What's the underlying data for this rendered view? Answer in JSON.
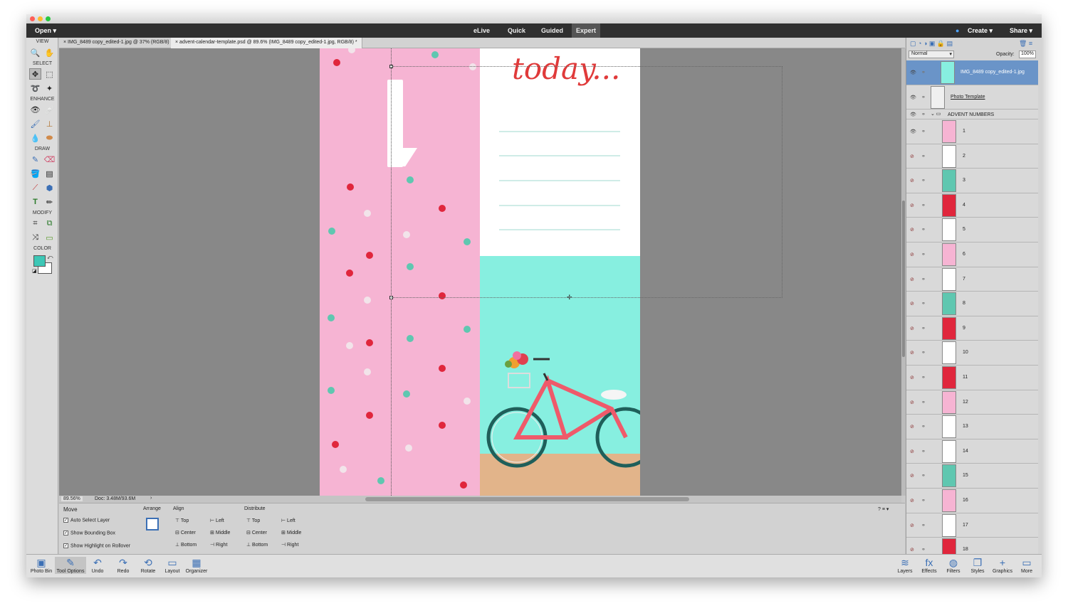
{
  "menubar": {
    "open_label": "Open",
    "modes": [
      "eLive",
      "Quick",
      "Guided",
      "Expert"
    ],
    "active_mode": "Expert",
    "create_label": "Create",
    "share_label": "Share"
  },
  "tabs": [
    {
      "label": "IMG_8489 copy_edited-1.jpg @ 37% (RGB/8)"
    },
    {
      "label": "advent-calendar-template.psd @ 89.6% (IMG_8489 copy_edited-1.jpg, RGB/8) *"
    }
  ],
  "toolbox": {
    "sections": [
      "VIEW",
      "SELECT",
      "ENHANCE",
      "DRAW",
      "MODIFY",
      "COLOR"
    ],
    "foreground_color": "#3dc7b6",
    "background_color": "#ffffff"
  },
  "canvas": {
    "headline": "today...",
    "pink": "#f6b4d3",
    "teal": "#87efe0",
    "dot_red": "#e0263c",
    "dot_teal": "#5fc7b0",
    "dot_light": "#f2e4ea"
  },
  "status": {
    "zoom": "89.56%",
    "doc": "Doc: 3.48M/93.6M"
  },
  "tool_options": {
    "tool": "Move",
    "checks": [
      "Auto Select Layer",
      "Show Bounding Box",
      "Show Highlight on Rollover"
    ],
    "arrange_label": "Arrange",
    "align_label": "Align",
    "align_items": [
      "Top",
      "Center",
      "Bottom",
      "Left",
      "Middle",
      "Right"
    ],
    "distribute_label": "Distribute",
    "distribute_items": [
      "Top",
      "Center",
      "Bottom",
      "Left",
      "Middle",
      "Right"
    ]
  },
  "bottom_left": [
    "Photo Bin",
    "Tool Options",
    "Undo",
    "Redo",
    "Rotate",
    "Layout",
    "Organizer"
  ],
  "bottom_right": [
    "Layers",
    "Effects",
    "Filters",
    "Styles",
    "Graphics",
    "More"
  ],
  "layers_panel": {
    "blend_mode": "Normal",
    "opacity_label": "Opacity:",
    "opacity_value": "100%",
    "layers": [
      {
        "name": "IMG_8489 copy_edited-1.jpg",
        "selected": true,
        "thumb": "#87efe0"
      },
      {
        "name": "Photo Template",
        "selected": false,
        "thumb": "#f0f0f0"
      },
      {
        "name": "ADVENT NUMBERS",
        "group": true
      }
    ],
    "advent": [
      {
        "name": "1",
        "thumb": "#f6b4d3"
      },
      {
        "name": "2",
        "thumb": "#ffffff"
      },
      {
        "name": "3",
        "thumb": "#5fc7b0"
      },
      {
        "name": "4",
        "thumb": "#e0263c"
      },
      {
        "name": "5",
        "thumb": "#ffffff"
      },
      {
        "name": "6",
        "thumb": "#f6b4d3"
      },
      {
        "name": "7",
        "thumb": "#ffffff"
      },
      {
        "name": "8",
        "thumb": "#5fc7b0"
      },
      {
        "name": "9",
        "thumb": "#e0263c"
      },
      {
        "name": "10",
        "thumb": "#ffffff"
      },
      {
        "name": "11",
        "thumb": "#e0263c"
      },
      {
        "name": "12",
        "thumb": "#f6b4d3"
      },
      {
        "name": "13",
        "thumb": "#ffffff"
      },
      {
        "name": "14",
        "thumb": "#ffffff"
      },
      {
        "name": "15",
        "thumb": "#5fc7b0"
      },
      {
        "name": "16",
        "thumb": "#f6b4d3"
      },
      {
        "name": "17",
        "thumb": "#ffffff"
      },
      {
        "name": "18",
        "thumb": "#e0263c"
      }
    ]
  }
}
